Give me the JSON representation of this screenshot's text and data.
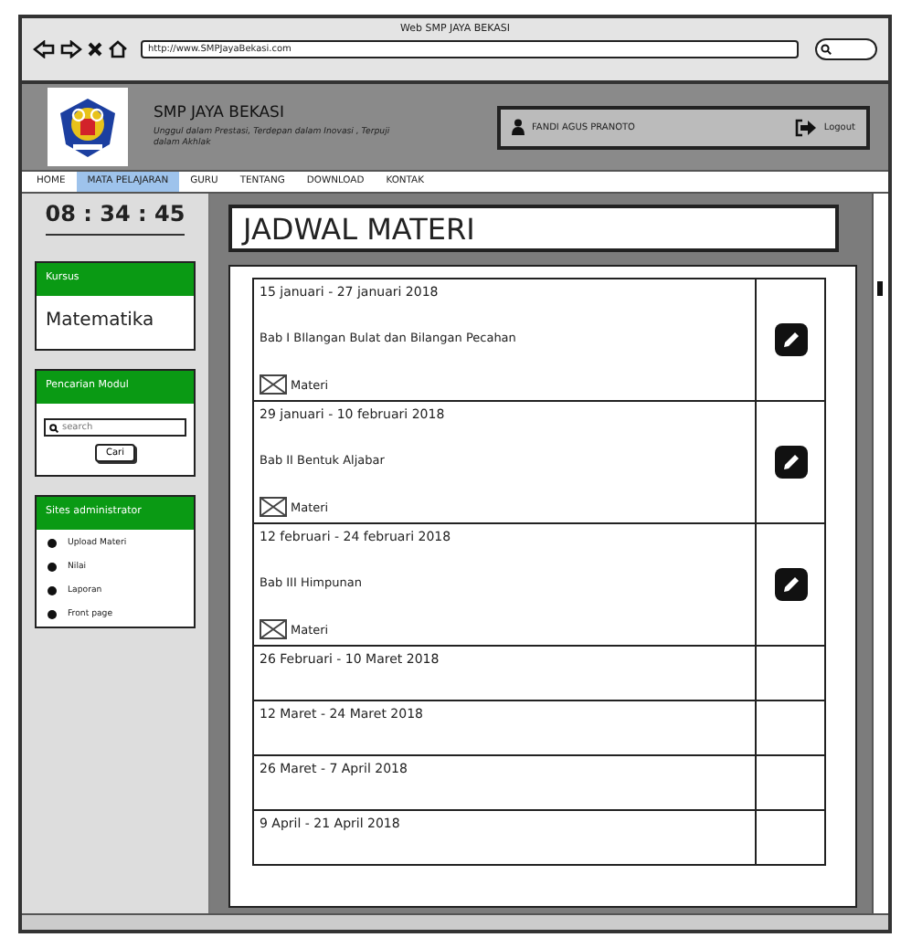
{
  "window": {
    "title": "Web SMP JAYA BEKASI",
    "url": "http://www.SMPJayaBekasi.com"
  },
  "header": {
    "school": "SMP JAYA BEKASI",
    "motto": "Unggul dalam Prestasi, Terdepan dalam Inovasi , Terpuji dalam Akhlak",
    "user": "FANDI AGUS PRANOTO",
    "logout": "Logout"
  },
  "nav": [
    {
      "label": "HOME",
      "selected": false
    },
    {
      "label": "MATA PELAJARAN",
      "selected": true
    },
    {
      "label": "GURU",
      "selected": false
    },
    {
      "label": "TENTANG",
      "selected": false
    },
    {
      "label": "DOWNLOAD",
      "selected": false
    },
    {
      "label": "KONTAK",
      "selected": false
    }
  ],
  "sidebar": {
    "clock": "08 : 34 : 45",
    "course": {
      "title": "Kursus",
      "value": "Matematika"
    },
    "search": {
      "title": "Pencarian Modul",
      "placeholder": "search",
      "button": "Cari"
    },
    "admin": {
      "title": "Sites administrator",
      "items": [
        "Upload Materi",
        "Nilai",
        "Laporan",
        "Front page"
      ]
    }
  },
  "main": {
    "title": "JADWAL MATERI",
    "rows": [
      {
        "date": "15 januari - 27 januari 2018",
        "chapter": "Bab I BIlangan Bulat dan Bilangan Pecahan",
        "attachment": "Materi",
        "editable": true
      },
      {
        "date": "29 januari - 10 februari 2018",
        "chapter": "Bab II Bentuk Aljabar",
        "attachment": "Materi",
        "editable": true
      },
      {
        "date": "12 februari - 24 februari 2018",
        "chapter": "Bab III Himpunan",
        "attachment": "Materi",
        "editable": true
      },
      {
        "date": "26 Februari - 10 Maret 2018",
        "editable": false
      },
      {
        "date": "12 Maret - 24 Maret 2018",
        "editable": false
      },
      {
        "date": "26 Maret - 7 April 2018",
        "editable": false
      },
      {
        "date": "9 April - 21 April 2018",
        "editable": false
      }
    ]
  }
}
